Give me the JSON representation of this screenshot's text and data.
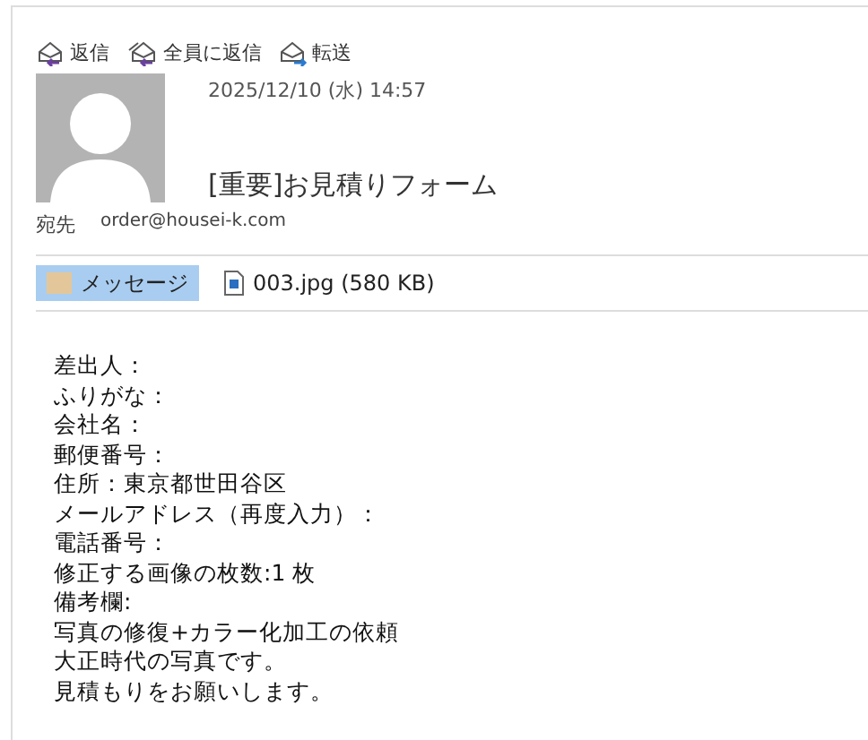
{
  "actions": [
    {
      "kind": "reply",
      "label": "返信"
    },
    {
      "kind": "reply-all",
      "label": "全員に返信"
    },
    {
      "kind": "forward",
      "label": "転送"
    }
  ],
  "date": "2025/12/10 (水) 14:57",
  "subject": "[重要]お見積りフォーム",
  "to": {
    "label": "宛先",
    "address": "order@housei-k.com"
  },
  "attachments": [
    {
      "kind": "message",
      "label": "メッセージ",
      "selected": true
    },
    {
      "kind": "file",
      "label": "003.jpg (580 KB)",
      "selected": false
    }
  ],
  "body": [
    "差出人：",
    "ふりがな：",
    "会社名：",
    "郵便番号：",
    "住所：東京都世田谷区",
    "メールアドレス（再度入力）：",
    "電話番号：",
    "修正する画像の枚数:1 枚",
    "備考欄:",
    "写真の修復+カラー化加工の依頼",
    "大正時代の写真です。",
    "見積もりをお願いします。"
  ]
}
